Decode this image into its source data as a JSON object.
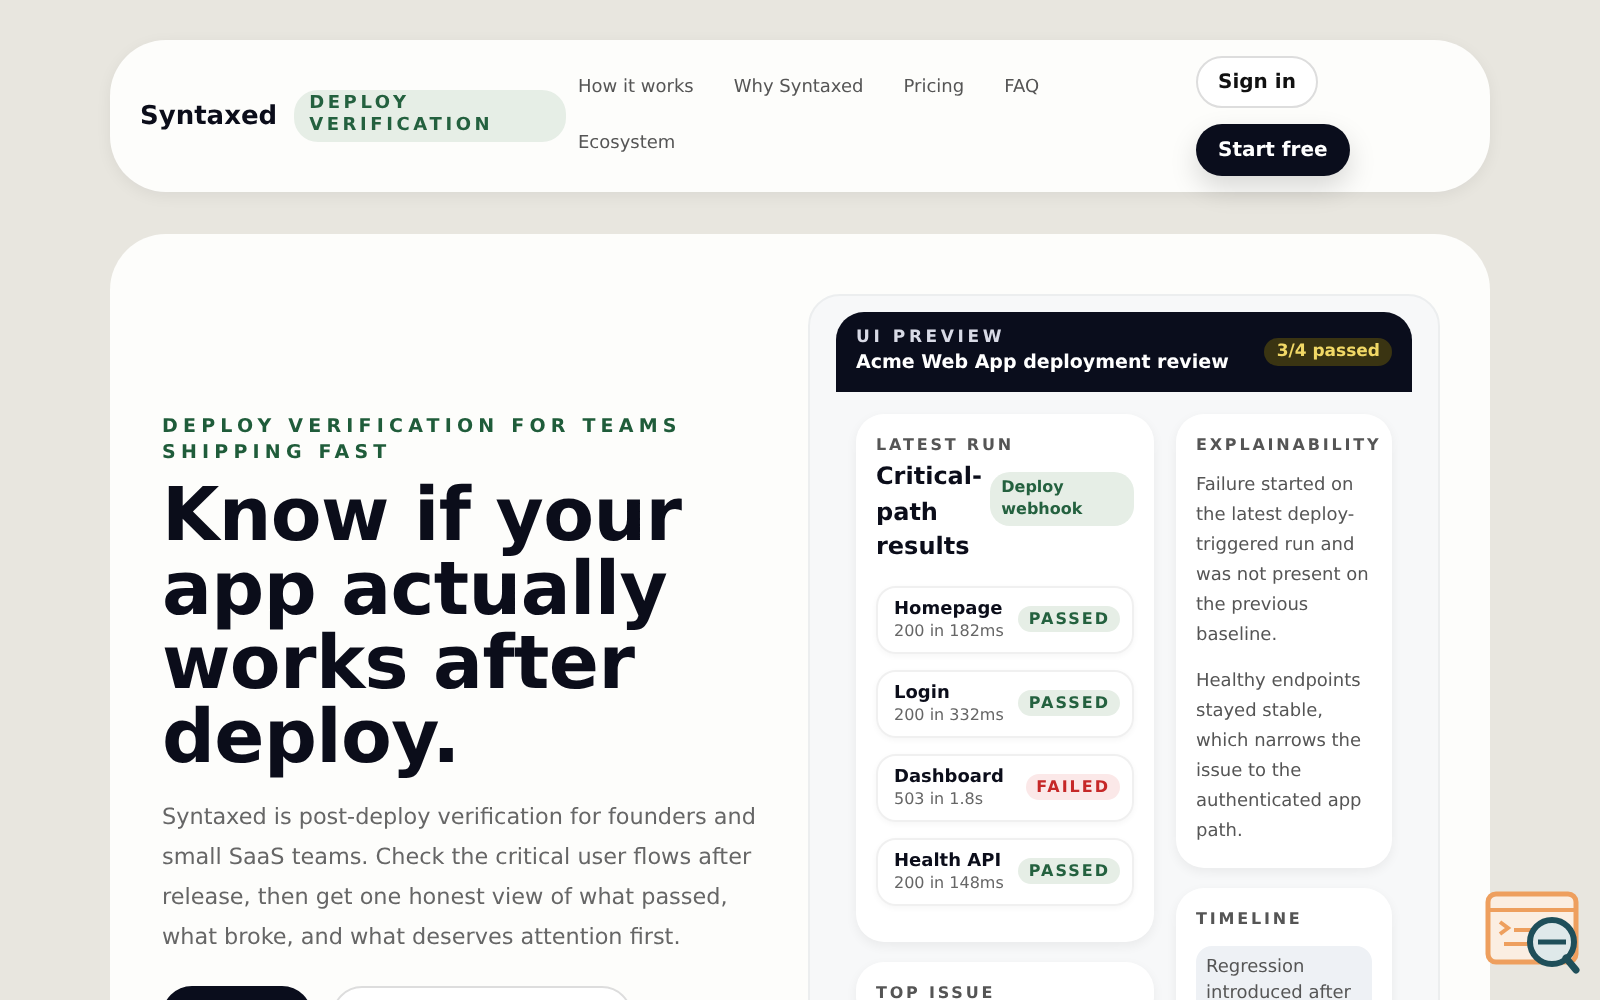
{
  "nav": {
    "brand": "Syntaxed",
    "badge": "DEPLOY VERIFICATION",
    "links": [
      "How it works",
      "Why Syntaxed",
      "Pricing",
      "FAQ",
      "Ecosystem"
    ],
    "actions": [
      {
        "kind": "secondary",
        "label": "Sign in"
      },
      {
        "kind": "primary",
        "label": "Start free"
      }
    ]
  },
  "hero": {
    "eyebrow": "DEPLOY VERIFICATION FOR TEAMS SHIPPING FAST",
    "headline": "Know if your app actually works after deploy.",
    "body": "Syntaxed is post-deploy verification for founders and small SaaS teams. Check the critical user flows after release, then get one honest view of what passed, what broke, and what deserves attention first.",
    "cta_buttons": [
      {
        "kind": "primary"
      },
      {
        "kind": "secondary"
      }
    ]
  },
  "preview": {
    "eyebrow": "UI PREVIEW",
    "title": "Acme Web App deployment review",
    "badge": "3/4 passed",
    "latest_run": {
      "label": "LATEST RUN",
      "title": "Critical-path results",
      "tag": "Deploy webhook",
      "checks": [
        {
          "name": "Homepage",
          "detail": "200 in 182ms",
          "passed": true,
          "label": "PASSED"
        },
        {
          "name": "Login",
          "detail": "200 in 332ms",
          "passed": true,
          "label": "PASSED"
        },
        {
          "name": "Dashboard",
          "detail": "503 in 1.8s",
          "passed": false,
          "label": "FAILED"
        },
        {
          "name": "Health API",
          "detail": "200 in 148ms",
          "passed": true,
          "label": "PASSED"
        }
      ]
    },
    "top_issue": {
      "label": "TOP ISSUE"
    },
    "explainability": {
      "label": "EXPLAINABILITY",
      "paragraphs": [
        "Failure started on the latest deploy-triggered run and was not present on the previous baseline.",
        "Healthy endpoints stayed stable, which narrows the issue to the authenticated app path."
      ]
    },
    "timeline": {
      "label": "TIMELINE",
      "entries": [
        "Regression introduced after"
      ]
    }
  }
}
